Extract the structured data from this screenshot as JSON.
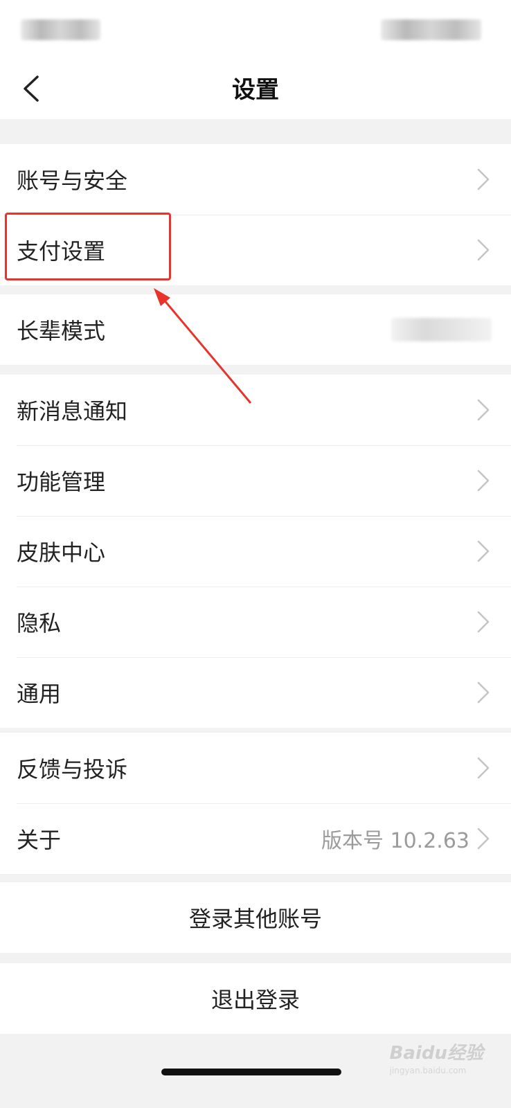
{
  "nav": {
    "title": "设置"
  },
  "groups": [
    {
      "items": [
        {
          "label": "账号与安全"
        },
        {
          "label": "支付设置"
        }
      ]
    },
    {
      "items": [
        {
          "label": "长辈模式"
        }
      ]
    },
    {
      "items": [
        {
          "label": "新消息通知"
        },
        {
          "label": "功能管理"
        },
        {
          "label": "皮肤中心"
        },
        {
          "label": "隐私"
        },
        {
          "label": "通用"
        }
      ]
    },
    {
      "items": [
        {
          "label": "反馈与投诉"
        },
        {
          "label": "关于",
          "value": "版本号 10.2.63"
        }
      ]
    }
  ],
  "actions": {
    "switch_account": "登录其他账号",
    "logout": "退出登录"
  },
  "watermark": {
    "brand": "Baidu经验",
    "url": "jingyan.baidu.com"
  },
  "colors": {
    "accent": "#e8332a",
    "background": "#f2f2f2",
    "secondary_text": "#9b9b9b"
  },
  "icons": {
    "back": "chevron-left-icon",
    "row_arrow": "chevron-right-icon"
  }
}
